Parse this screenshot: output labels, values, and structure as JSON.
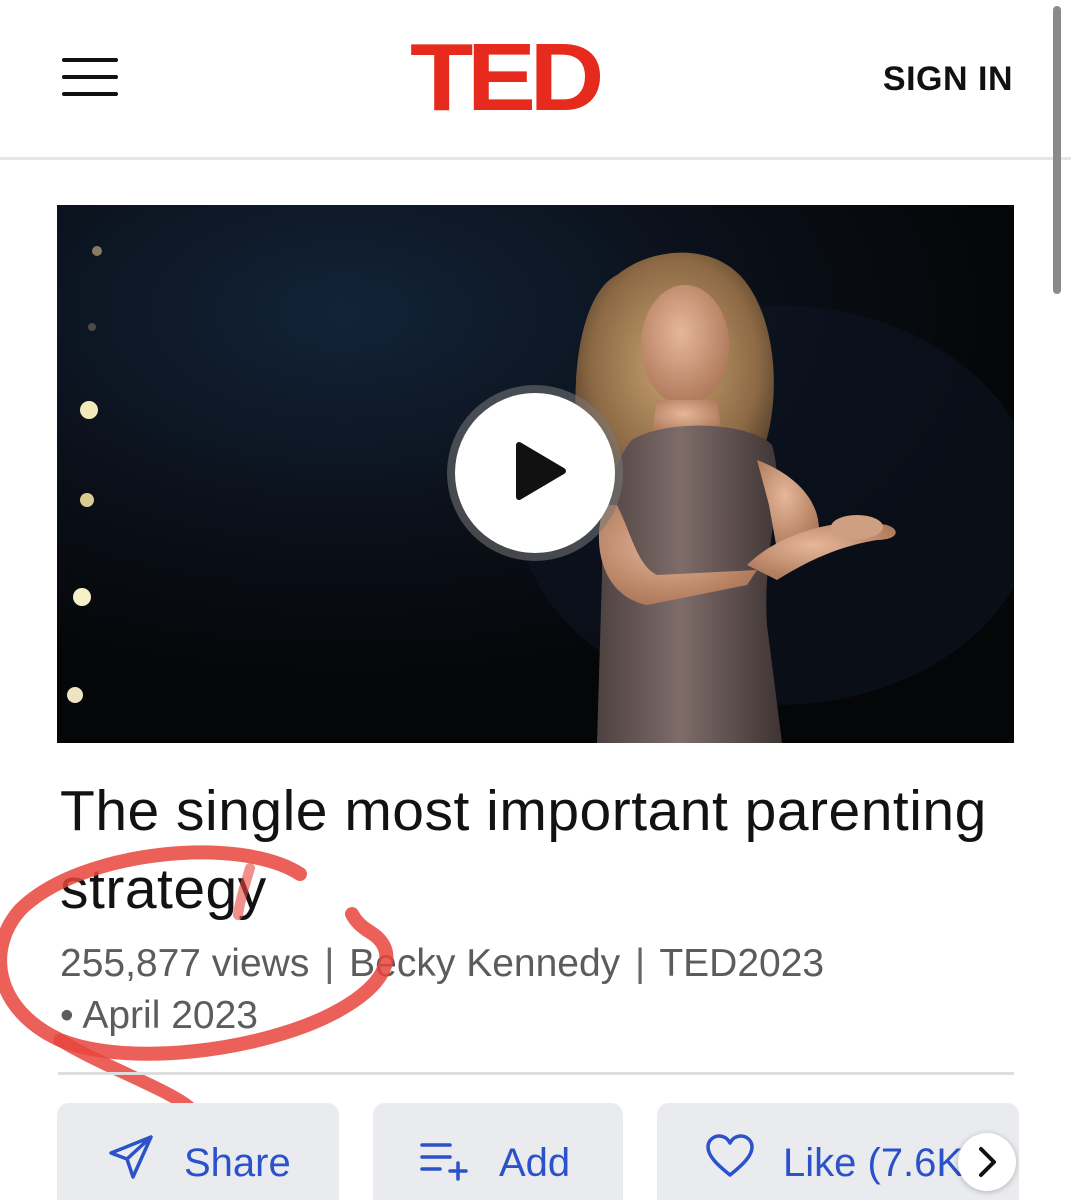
{
  "header": {
    "logo_text": "TED",
    "logo_color": "#e62b1e",
    "sign_in_label": "SIGN IN",
    "menu_icon": "hamburger-menu-icon"
  },
  "video": {
    "thumbnail_description_icon": "video-thumbnail",
    "play_icon": "play-icon"
  },
  "talk": {
    "title": "The single most important parenting strategy",
    "views": "255,877 views",
    "separator": "|",
    "speaker": "Becky Kennedy",
    "event": "TED2023",
    "date": "• April 2023"
  },
  "actions": {
    "share_label": "Share",
    "share_icon": "send-icon",
    "add_label": "Add",
    "add_icon": "add-to-list-icon",
    "like_label": "Like (7.6K",
    "like_icon": "heart-icon",
    "more_icon": "chevron-right-icon",
    "accent_color": "#2b52c9"
  },
  "annotation": {
    "color": "#e8453c"
  }
}
